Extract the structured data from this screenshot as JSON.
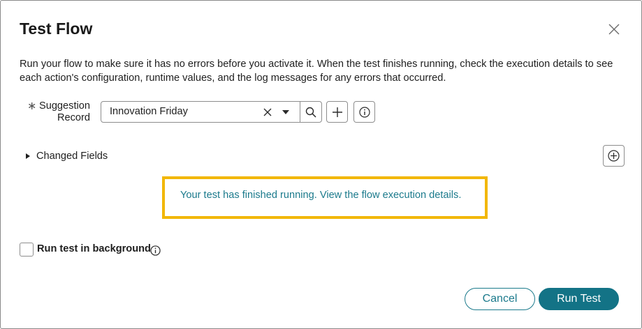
{
  "dialog": {
    "title": "Test Flow",
    "description": "Run your flow to make sure it has no errors before you activate it. When the test finishes running, check the execution details to see each action's configuration, runtime values, and the log messages for any errors that occurred."
  },
  "suggestion_record": {
    "required_marker": "∗",
    "label": "Suggestion Record",
    "value": "Innovation Friday"
  },
  "changed_fields": {
    "label": "Changed Fields"
  },
  "result": {
    "message": "Your test has finished running. View the flow execution details."
  },
  "background": {
    "label": "Run test in background",
    "checked": false
  },
  "footer": {
    "cancel_label": "Cancel",
    "run_label": "Run Test"
  },
  "colors": {
    "accent": "#137386",
    "link": "#1b7a8c",
    "highlight": "#f2b705"
  },
  "icons": {
    "close": "close-icon",
    "clear": "clear-icon",
    "dropdown": "chevron-down-icon",
    "search": "search-icon",
    "add": "plus-icon",
    "info": "info-icon",
    "expand": "caret-right-icon",
    "add_field": "plus-circle-icon"
  }
}
